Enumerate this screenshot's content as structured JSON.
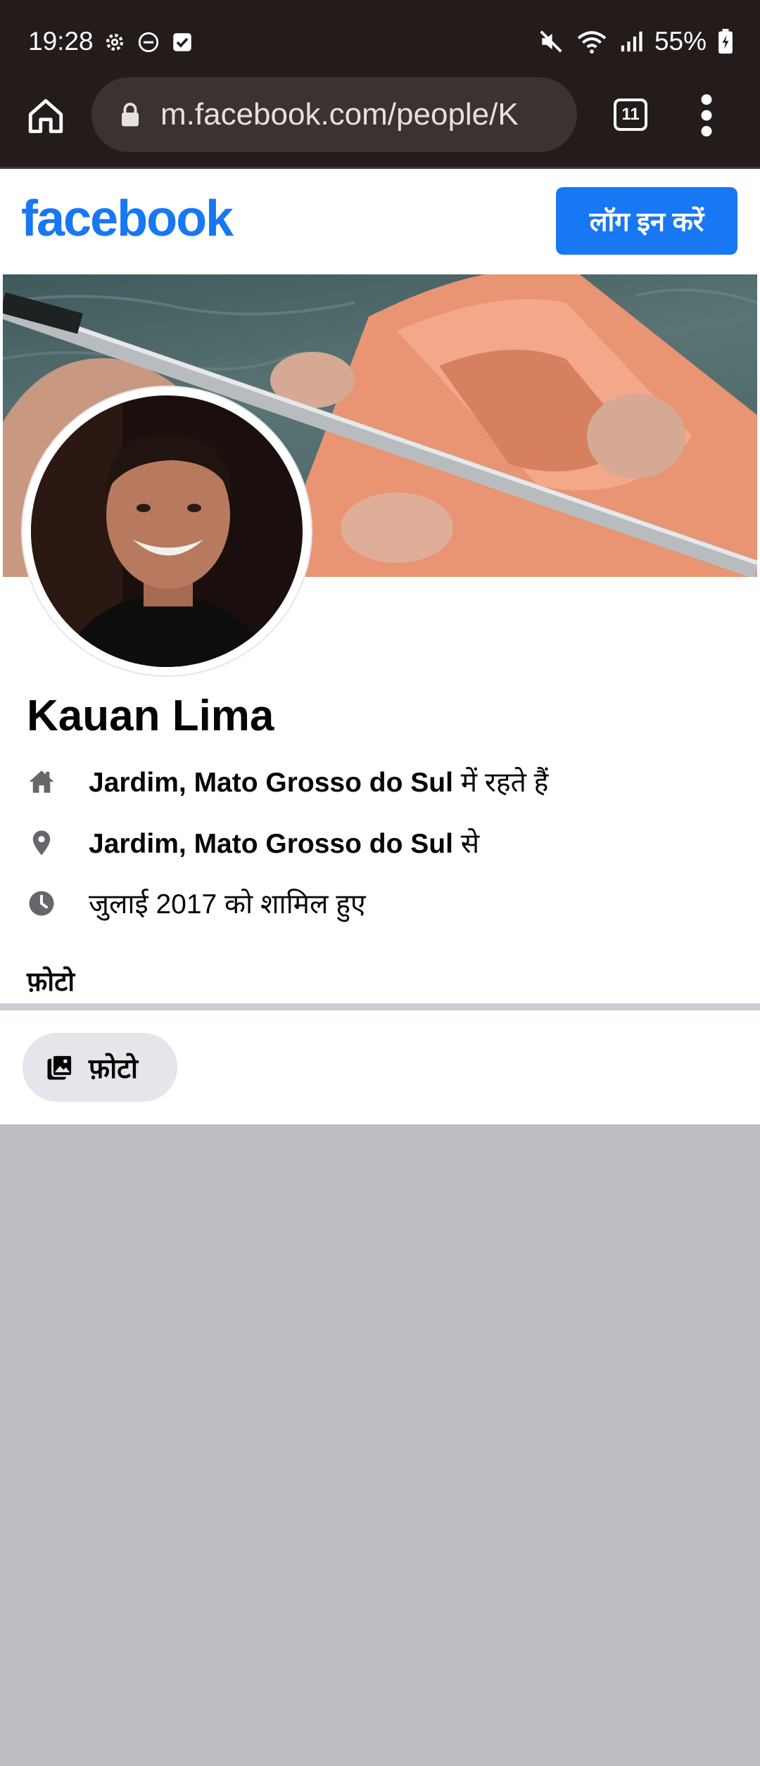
{
  "status_bar": {
    "time": "19:28",
    "battery": "55%"
  },
  "browser": {
    "url": "m.facebook.com/people/K",
    "tab_count": "11"
  },
  "header": {
    "logo": "facebook",
    "login_label": "लॉग इन करें"
  },
  "profile": {
    "name": "Kauan Lima",
    "lives_place": "Jardim, Mato Grosso do Sul",
    "lives_suffix": " में रहते हैं",
    "from_place": "Jardim, Mato Grosso do Sul",
    "from_suffix": " से",
    "joined": "जुलाई 2017 को शामिल हुए"
  },
  "photos": {
    "heading": "फ़ोटो",
    "button_label": "फ़ोटो"
  },
  "icons": {
    "home": "home-icon",
    "lock": "lock-icon",
    "menu": "kebab-menu-icon",
    "lives": "house-icon",
    "from": "location-pin-icon",
    "joined": "clock-icon",
    "photos": "photos-icon"
  },
  "colors": {
    "brand": "#1877f2",
    "status_bar_bg": "#231c1b",
    "page_bg": "#bcbec2"
  }
}
